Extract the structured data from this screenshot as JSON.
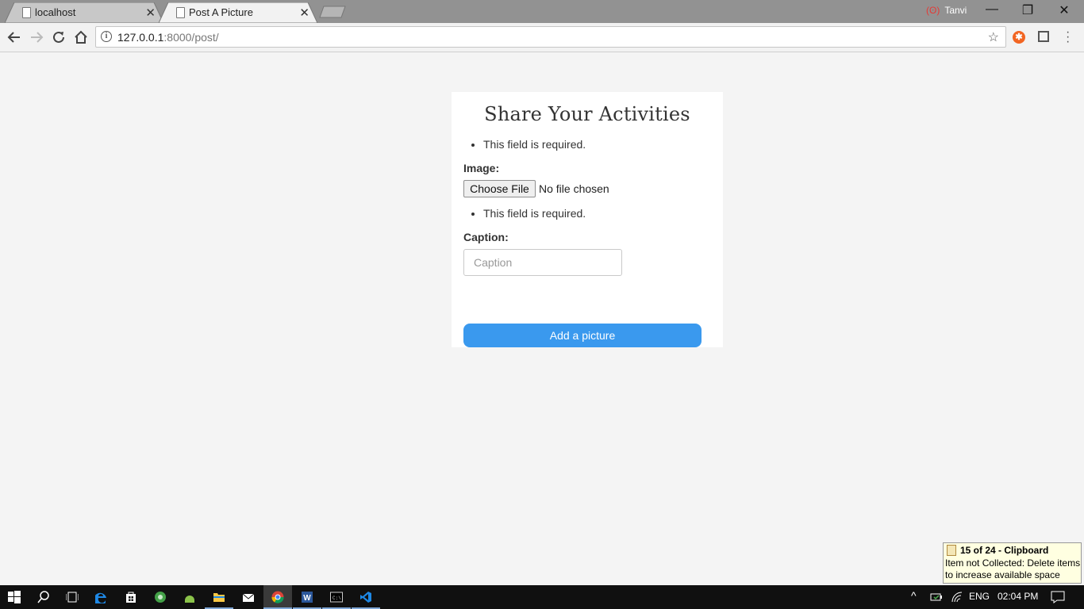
{
  "browser": {
    "tabs": [
      {
        "label": "localhost",
        "active": false
      },
      {
        "label": "Post A Picture",
        "active": true
      }
    ],
    "profile_name": "Tanvi",
    "url_host": "127.0.0.1",
    "url_rest": ":8000/post/"
  },
  "page": {
    "title": "Share Your Activities",
    "form_error": "This field is required.",
    "image_label": "Image:",
    "file_button_label": "Choose File",
    "file_status": "No file chosen",
    "image_error": "This field is required.",
    "caption_label": "Caption:",
    "caption_placeholder": "Caption",
    "caption_value": "",
    "submit_label": "Add a picture"
  },
  "notification": {
    "title": "15 of 24 - Clipboard",
    "message": "Item not Collected: Delete items to increase available space"
  },
  "taskbar": {
    "apps": [
      "start",
      "search",
      "task-view",
      "edge",
      "store",
      "cortana-app",
      "android-studio",
      "file-explorer",
      "mail",
      "chrome",
      "word",
      "cmd",
      "vscode"
    ],
    "language": "ENG",
    "time": "02:04 PM"
  },
  "colors": {
    "accent_button": "#3a99ee",
    "page_background": "#f4f4f4",
    "card_background": "#ffffff",
    "titlebar": "#929292"
  }
}
